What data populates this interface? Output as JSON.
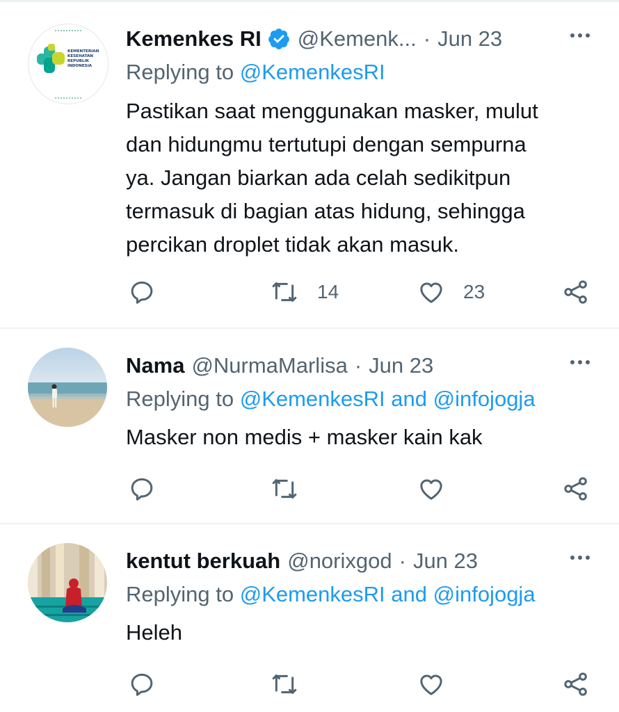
{
  "tweets": [
    {
      "name": "Kemenkes RI",
      "verified": true,
      "handle": "@Kemenk...",
      "separator": "·",
      "date": "Jun 23",
      "replying_prefix": "Replying to ",
      "replying_to": "@KemenkesRI",
      "replying_and": "",
      "replying_to_2": "",
      "text_lines": [
        "Pastikan saat menggunakan masker, mulut",
        "dan hidungmu tertutupi dengan sempurna",
        "ya. Jangan biarkan ada celah sedikitpun",
        "termasuk di bagian atas hidung, sehingga",
        "percikan droplet tidak akan masuk."
      ],
      "reply_count": "",
      "retweet_count": "14",
      "like_count": "23",
      "avatar_logo_text": "KEMENTERIAN KESEHATAN REPUBLIK INDONESIA"
    },
    {
      "name": "Nama",
      "verified": false,
      "handle": "@NurmaMarlisa",
      "separator": "·",
      "date": "Jun 23",
      "replying_prefix": "Replying to ",
      "replying_to": "@KemenkesRI",
      "replying_and": " and ",
      "replying_to_2": "@infojogja",
      "text_lines": [
        "Masker non medis + masker kain kak"
      ],
      "reply_count": "",
      "retweet_count": "",
      "like_count": ""
    },
    {
      "name": "kentut berkuah",
      "verified": false,
      "handle": "@norixgod",
      "separator": "·",
      "date": "Jun 23",
      "replying_prefix": "Replying to ",
      "replying_to": "@KemenkesRI",
      "replying_and": " and ",
      "replying_to_2": "@infojogja",
      "text_lines": [
        "Heleh"
      ],
      "reply_count": "",
      "retweet_count": "",
      "like_count": ""
    }
  ],
  "colors": {
    "text": "#0f1419",
    "secondary": "#536471",
    "link": "#1d9bf0",
    "verified": "#1d9bf0",
    "divider": "#eff3f4"
  },
  "icons": [
    "verified-badge-icon",
    "more-icon",
    "reply-icon",
    "retweet-icon",
    "like-icon",
    "share-icon"
  ]
}
